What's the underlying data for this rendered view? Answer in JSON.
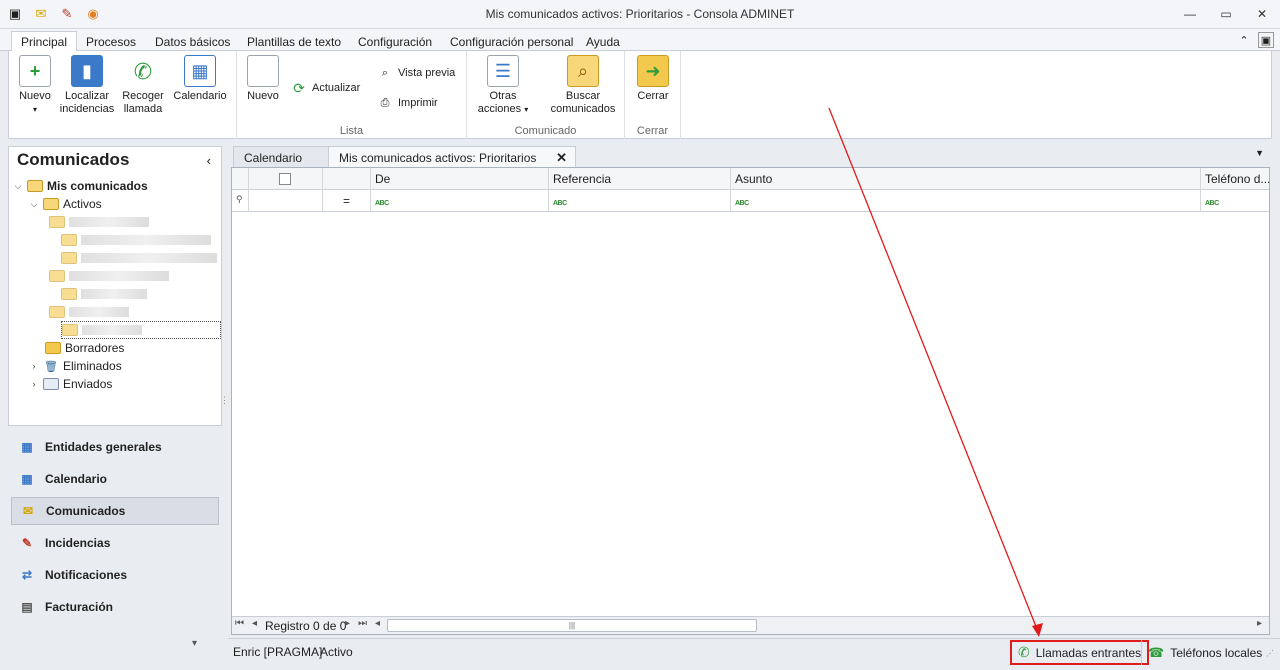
{
  "window": {
    "title": "Mis comunicados activos: Prioritarios - Consola ADMINET",
    "quick_access_icons": [
      "app-icon",
      "envelope-icon",
      "clipboard-icon",
      "signal-icon"
    ],
    "controls": [
      "minimize-icon",
      "restore-icon",
      "close-icon"
    ]
  },
  "ribbon": {
    "tabs": [
      "Principal",
      "Procesos",
      "Datos básicos",
      "Plantillas de texto",
      "Configuración",
      "Configuración personal",
      "Ayuda"
    ],
    "active_tab": "Principal",
    "group_principal": {
      "nuevo": "Nuevo",
      "localizar": [
        "Localizar",
        "incidencias"
      ],
      "recoger": [
        "Recoger",
        "llamada"
      ],
      "calendario": "Calendario"
    },
    "group_lista": {
      "label": "Lista",
      "nuevo": "Nuevo",
      "actualizar": "Actualizar",
      "vista_previa": "Vista previa",
      "imprimir": "Imprimir"
    },
    "group_comunicado": {
      "label": "Comunicado",
      "otras": [
        "Otras",
        "acciones"
      ],
      "buscar": [
        "Buscar",
        "comunicados"
      ]
    },
    "group_cerrar": {
      "label": "Cerrar",
      "cerrar": "Cerrar"
    }
  },
  "left_panel": {
    "title": "Comunicados",
    "tree": {
      "root": "Mis comunicados",
      "activos": "Activos",
      "borradores": "Borradores",
      "eliminados": "Eliminados",
      "enviados": "Enviados"
    }
  },
  "nav": {
    "items": [
      "Entidades generales",
      "Calendario",
      "Comunicados",
      "Incidencias",
      "Notificaciones",
      "Facturación"
    ],
    "active": "Comunicados"
  },
  "doc_tabs": {
    "tabs": [
      "Calendario",
      "Mis comunicados activos: Prioritarios"
    ],
    "active": "Mis comunicados activos: Prioritarios"
  },
  "grid": {
    "columns": [
      "De",
      "Referencia",
      "Asunto",
      "Teléfono d..."
    ],
    "filter_operator": "=",
    "filter_abc": "ABC",
    "record_text": "Registro 0 de 0"
  },
  "status": {
    "user": "Enric [PRAGMA]",
    "state": "Activo",
    "llamadas": "Llamadas entrantes",
    "telefonos": "Teléfonos locales"
  },
  "colors": {
    "annotation": "#e01b1b",
    "accent_green": "#2d8a2d",
    "folder_yellow": "#f2c94c"
  }
}
